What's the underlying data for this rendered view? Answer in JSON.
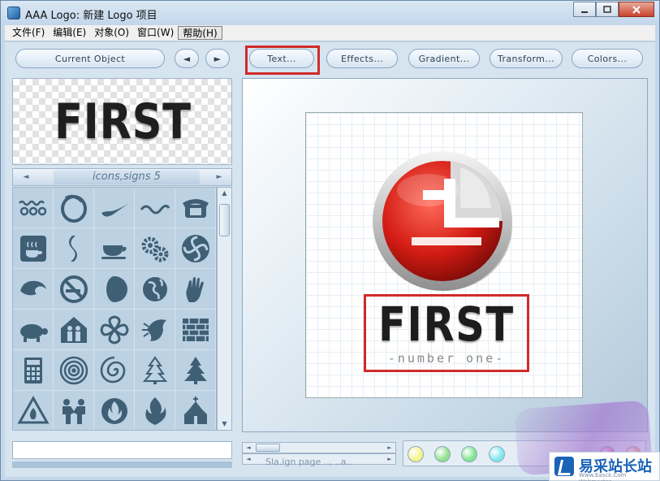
{
  "window": {
    "title": "AAA Logo: 新建 Logo 项目"
  },
  "menu": {
    "items": [
      "文件(F)",
      "编辑(E)",
      "对象(O)",
      "窗口(W)",
      "帮助(H)"
    ]
  },
  "toolbar": {
    "current_object": "Current Object",
    "prev": "◄",
    "next": "►",
    "text": "Text...",
    "effects": "Effects...",
    "gradient": "Gradient...",
    "transform": "Transform...",
    "colors": "Colors..."
  },
  "preview": {
    "word": "FIRST"
  },
  "category": {
    "label": "icons,signs 5"
  },
  "logo": {
    "title": "FIRST",
    "subtitle": "-number one-"
  },
  "status": {
    "ghost_text": "Sla.ign page    .., ..a.."
  },
  "swatches": {
    "colors": [
      "#f4f28a",
      "#8fe08c",
      "#7fe38f",
      "#7fe6ea",
      "#e667a8",
      "#ef8b6a"
    ]
  },
  "watermark": {
    "text": "易采站长站",
    "url": "Www.Easck.Com Webmaster"
  }
}
